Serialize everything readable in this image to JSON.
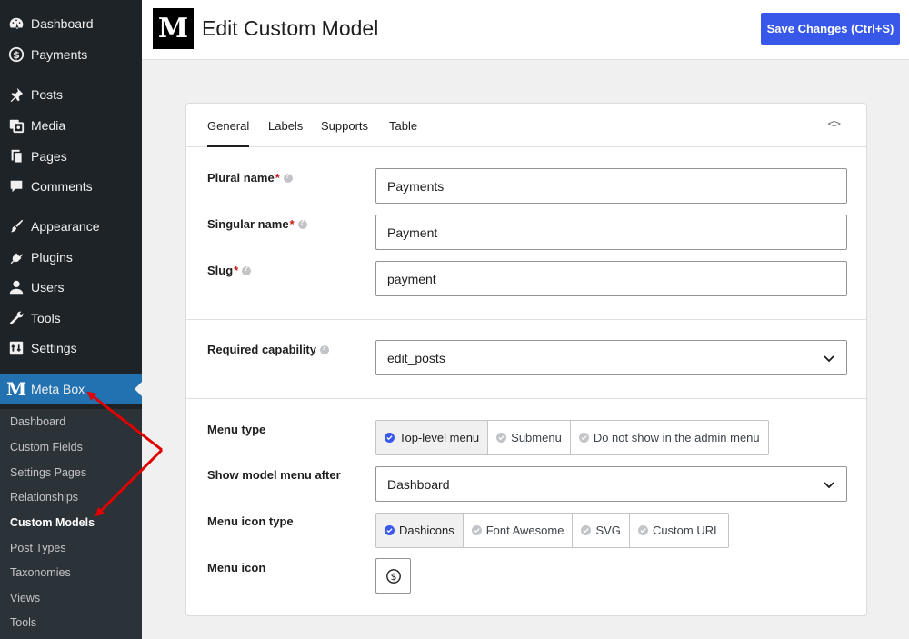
{
  "sidebar": {
    "items": [
      {
        "label": "Dashboard",
        "icon": "dashboard-icon"
      },
      {
        "label": "Payments",
        "icon": "dollar-icon"
      },
      {
        "label": "Posts",
        "icon": "pin-icon"
      },
      {
        "label": "Media",
        "icon": "media-icon"
      },
      {
        "label": "Pages",
        "icon": "pages-icon"
      },
      {
        "label": "Comments",
        "icon": "comments-icon"
      },
      {
        "label": "Appearance",
        "icon": "brush-icon"
      },
      {
        "label": "Plugins",
        "icon": "plugin-icon"
      },
      {
        "label": "Users",
        "icon": "user-icon"
      },
      {
        "label": "Tools",
        "icon": "wrench-icon"
      },
      {
        "label": "Settings",
        "icon": "settings-icon"
      }
    ],
    "active": {
      "label": "Meta Box",
      "logo": "M"
    },
    "submenu": [
      "Dashboard",
      "Custom Fields",
      "Settings Pages",
      "Relationships",
      "Custom Models",
      "Post Types",
      "Taxonomies",
      "Views",
      "Tools"
    ]
  },
  "header": {
    "logo": "M",
    "title": "Edit Custom Model",
    "save_label": "Save Changes (Ctrl+S)"
  },
  "tabs": [
    "General",
    "Labels",
    "Supports",
    "Table"
  ],
  "code_toggle": "<>",
  "fields": {
    "plural": {
      "label": "Plural name",
      "value": "Payments"
    },
    "singular": {
      "label": "Singular name",
      "value": "Payment"
    },
    "slug": {
      "label": "Slug",
      "value": "payment"
    },
    "capability": {
      "label": "Required capability",
      "value": "edit_posts"
    },
    "menu_type": {
      "label": "Menu type",
      "options": [
        "Top-level menu",
        "Submenu",
        "Do not show in the admin menu"
      ]
    },
    "menu_after": {
      "label": "Show model menu after",
      "value": "Dashboard"
    },
    "icon_type": {
      "label": "Menu icon type",
      "options": [
        "Dashicons",
        "Font Awesome",
        "SVG",
        "Custom URL"
      ]
    },
    "menu_icon": {
      "label": "Menu icon",
      "icon": "dollar-circle-icon"
    }
  },
  "required_mark": "*",
  "colors": {
    "accent": "#3858e9",
    "sidebar": "#1d2327",
    "active_menu": "#2271b1",
    "annotation": "#e00000"
  }
}
